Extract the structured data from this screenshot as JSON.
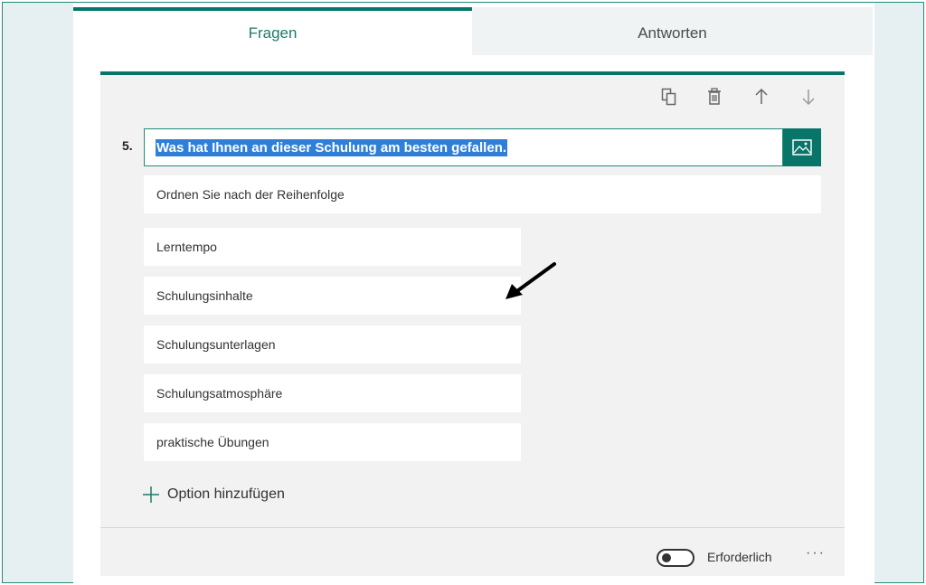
{
  "tabs": [
    {
      "label": "Fragen",
      "active": true
    },
    {
      "label": "Antworten",
      "active": false
    }
  ],
  "toolbar": {
    "icons": [
      "copy-icon",
      "trash-icon",
      "arrow-up-icon",
      "arrow-down-icon"
    ]
  },
  "question": {
    "number": "5.",
    "title": "Was hat Ihnen an dieser Schulung am besten gefallen.",
    "subtitle": "Ordnen Sie nach der Reihenfolge",
    "options": [
      "Lerntempo",
      "Schulungsinhalte",
      "Schulungsunterlagen",
      "Schulungsatmosphäre",
      "praktische Übungen"
    ],
    "add_option_label": "Option hinzufügen"
  },
  "footer": {
    "required_label": "Erforderlich",
    "required_on": false,
    "more_label": "···"
  },
  "colors": {
    "accent": "#077568",
    "selection": "#2f7fd8",
    "background": "#e6eff2"
  }
}
